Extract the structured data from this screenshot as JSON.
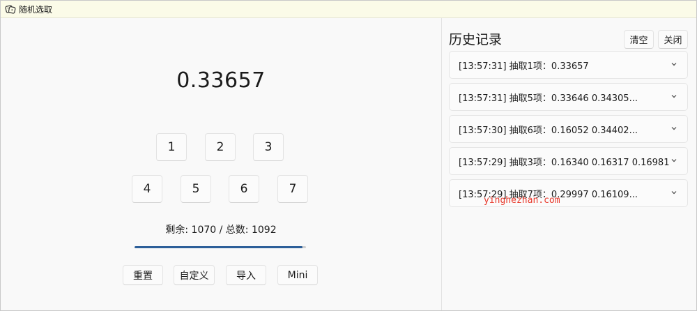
{
  "window": {
    "title": "随机选取",
    "app_icon": "dice-icon"
  },
  "main": {
    "result": "0.33657",
    "number_buttons": [
      "1",
      "2",
      "3",
      "4",
      "5",
      "6",
      "7"
    ],
    "remaining_text": "剩余: 1070 / 总数: 1092",
    "progress": {
      "remaining": 1070,
      "total": 1092,
      "fraction": 0.98,
      "color": "#2d5f99"
    },
    "actions": {
      "reset": "重置",
      "custom": "自定义",
      "import": "导入",
      "mini": "Mini"
    }
  },
  "history": {
    "title": "历史记录",
    "clear_label": "清空",
    "close_label": "关闭",
    "items": [
      {
        "text": "[13:57:31] 抽取1项：0.33657"
      },
      {
        "text": "[13:57:31] 抽取5项：0.33646 0.34305..."
      },
      {
        "text": "[13:57:30] 抽取6项：0.16052 0.34402..."
      },
      {
        "text": "[13:57:29] 抽取3项：0.16340 0.16317 0.16981"
      },
      {
        "text": "[13:57:29] 抽取7项：0.29997 0.16109..."
      }
    ]
  },
  "watermark": "yinghezhan.com"
}
